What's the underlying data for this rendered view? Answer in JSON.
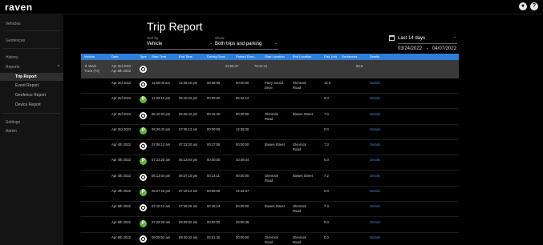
{
  "app": {
    "logo": "raven"
  },
  "topbar": {
    "icons": [
      "user-icon",
      "help-icon"
    ],
    "help_glyph": "?",
    "user_glyph": "●"
  },
  "sidebar": {
    "vehicles": "Vehicles",
    "geofences": "Geofences",
    "history": "History",
    "reports": "Reports",
    "reports_caret": "^",
    "trip_report": "Trip Report",
    "event_report": "Event Report",
    "geofence_report": "Geofence Report",
    "device_report": "Device Report",
    "settings": "Settings",
    "admin": "Admin"
  },
  "page": {
    "title": "Trip Report"
  },
  "controls": {
    "sort_label": "Sort by:",
    "sort_value": "Vehicle",
    "show_label": "Show:",
    "show_value": "Both trips and parking",
    "range_value": "Last 14 days",
    "date_from": "03/24/2022",
    "date_to": "04/07/2022",
    "date_sep": "-",
    "caret": "⌄"
  },
  "table": {
    "headers": [
      "Vehicle",
      "Date",
      "Type",
      "Start Time",
      "End Time",
      "Driving Dura...",
      "Parked Dura...",
      "Start Location",
      "End Location",
      "Dist. (mi)",
      "Geofences",
      "Details"
    ],
    "group": {
      "vehicle_line1": "▼ Work",
      "vehicle_line2": "Truck (73)",
      "date_line1": "Apr 3rd 2022 -",
      "date_line2": "Apr 6th 2022",
      "driving": "02:55:47",
      "parked": "75:12:41",
      "dist": "56.8"
    },
    "rows": [
      {
        "date": "Apr 3rd 2022",
        "type": "drive",
        "start": "11:58:05 am",
        "end": "12:26:10 pm",
        "driving": "00:28:05",
        "parked": "00:00:00",
        "start_loc_1": "Parry Sound",
        "start_loc_2": "Drive",
        "end_loc_1": "Glenrock",
        "end_loc_2": "Road",
        "dist": "12.0",
        "details": "Details"
      },
      {
        "date": "Apr 3rd 2022",
        "type": "park",
        "start": "12:26:10 pm",
        "end": "06:10:22 pm",
        "driving": "00:00:00",
        "parked": "05:44:12",
        "start_loc_1": "",
        "start_loc_2": "",
        "end_loc_1": "",
        "end_loc_2": "",
        "dist": "0.0",
        "details": "Details"
      },
      {
        "date": "Apr 3rd 2022",
        "type": "drive",
        "start": "06:10:22 pm",
        "end": "06:26:42 pm",
        "driving": "00:16:20",
        "parked": "00:00:00",
        "start_loc_1": "Glenrock",
        "start_loc_2": "Road",
        "end_loc_1": "Bowes Street",
        "end_loc_2": "",
        "dist": "7.4",
        "details": "Details"
      },
      {
        "date": "Apr 3rd 2022",
        "type": "park",
        "start": "06:26:42 pm",
        "end": "07:06:12 am",
        "driving": "00:00:00",
        "parked": "12:39:30",
        "start_loc_1": "",
        "start_loc_2": "",
        "end_loc_1": "",
        "end_loc_2": "",
        "dist": "0.0",
        "details": "Details"
      },
      {
        "date": "Apr 4th 2022",
        "type": "drive",
        "start": "07:06:12 am",
        "end": "07:23:20 am",
        "driving": "00:17:08",
        "parked": "00:00:00",
        "start_loc_1": "Bowes Street",
        "start_loc_2": "",
        "end_loc_1": "Glenrock",
        "end_loc_2": "Road",
        "dist": "7.3",
        "details": "Details"
      },
      {
        "date": "Apr 4th 2022",
        "type": "park",
        "start": "07:23:20 am",
        "end": "06:13:04 pm",
        "driving": "00:00:00",
        "parked": "10:49:44",
        "start_loc_1": "",
        "start_loc_2": "",
        "end_loc_1": "",
        "end_loc_2": "",
        "dist": "0.0",
        "details": "Details"
      },
      {
        "date": "Apr 4th 2022",
        "type": "drive",
        "start": "06:13:04 pm",
        "end": "06:27:15 pm",
        "driving": "00:14:11",
        "parked": "00:00:00",
        "start_loc_1": "Glenrock",
        "start_loc_2": "Road",
        "end_loc_1": "Bowes Street",
        "end_loc_2": "",
        "dist": "7.2",
        "details": "Details"
      },
      {
        "date": "Apr 4th 2022",
        "type": "park",
        "start": "06:27:15 pm",
        "end": "07:10:12 am",
        "driving": "00:00:00",
        "parked": "12:42:57",
        "start_loc_1": "",
        "start_loc_2": "",
        "end_loc_1": "",
        "end_loc_2": "",
        "dist": "0.0",
        "details": "Details"
      },
      {
        "date": "Apr 5th 2022",
        "type": "drive",
        "start": "07:10:12 am",
        "end": "07:28:26 am",
        "driving": "00:18:14",
        "parked": "00:00:00",
        "start_loc_1": "Bowes Street",
        "start_loc_2": "",
        "end_loc_1": "Glenrock",
        "end_loc_2": "Road",
        "dist": "7.3",
        "details": "Details"
      },
      {
        "date": "Apr 5th 2022",
        "type": "park",
        "start": "07:28:26 am",
        "end": "09:29:02 am",
        "driving": "00:00:00",
        "parked": "26:00:36",
        "start_loc_1": "",
        "start_loc_2": "",
        "end_loc_1": "",
        "end_loc_2": "",
        "dist": "0.0",
        "details": "Details"
      },
      {
        "date": "Apr 6th 2022",
        "type": "drive",
        "start": "09:29:02 am",
        "end": "09:30:42 am",
        "driving": "00:01:40",
        "parked": "00:00:00",
        "start_loc_1": "Glenrock",
        "start_loc_2": "Road",
        "end_loc_1": "Glenrock",
        "end_loc_2": "Road",
        "dist": "0.0",
        "details": "Details"
      }
    ]
  }
}
